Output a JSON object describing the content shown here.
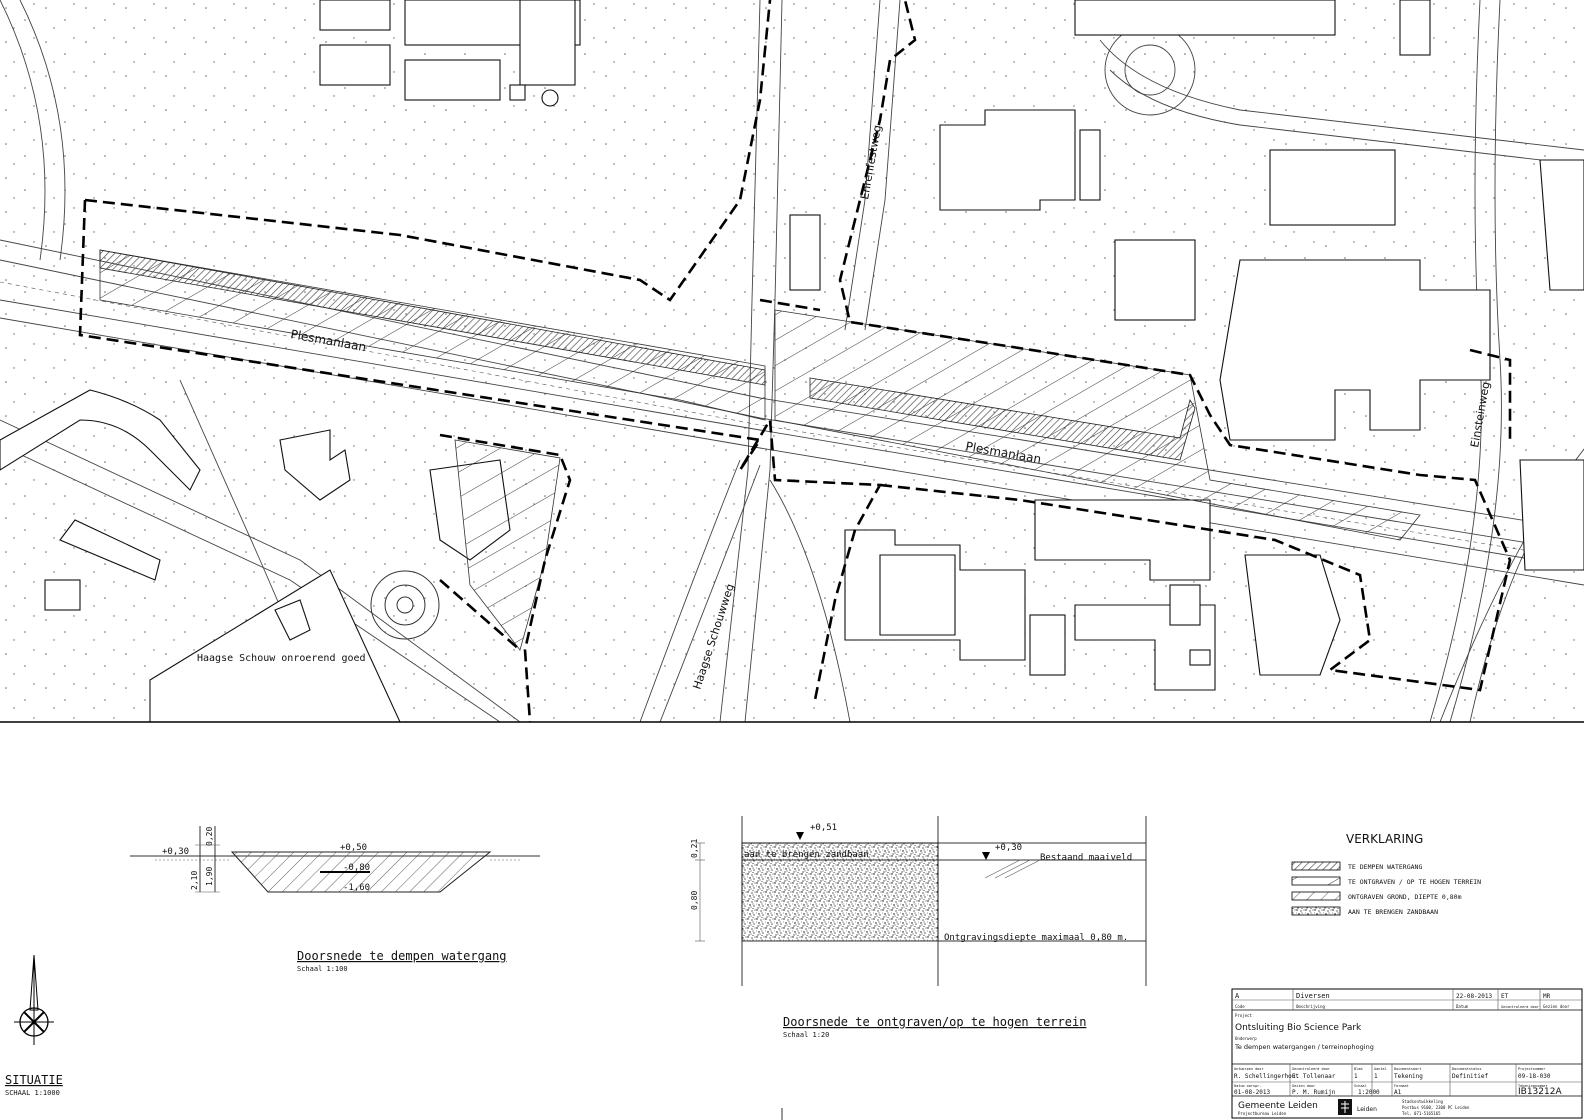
{
  "map": {
    "street_plesmanlaan_west": "Plesmanlaan",
    "street_plesmanlaan_east": "Plesmanlaan",
    "street_ehrenfestweg": "Ehrenfestweg",
    "street_einsteinweg": "Einsteinweg",
    "street_haagse_schouwweg": "Haagse Schouwweg",
    "label_haagse_schouw": "Haagse Schouw onroerend goed"
  },
  "section_water": {
    "title": "Doorsnede te dempen watergang",
    "scale": "Schaal 1:100",
    "level_left": "+0,30",
    "level_top": "+0,50",
    "level_mid": "-0,80",
    "level_bottom": "-1,60",
    "dim_top": "0,20",
    "dim_height": "2,10",
    "dim_inner": "1,90"
  },
  "section_terrain": {
    "title": "Doorsnede te ontgraven/op te hogen terrein",
    "scale": "Schaal 1:20",
    "level_top": "+0,51",
    "level_right": "+0,30",
    "label_fill": "aan te brengen zandbaan",
    "label_existing": "Bestaand maaiveld",
    "label_depth": "Ontgravingsdiepte maximaal 0,80 m.",
    "dim_top": "0,21",
    "dim_main": "0,80"
  },
  "legend": {
    "title": "VERKLARING",
    "items": [
      "TE DEMPEN WATERGANG",
      "TE ONTGRAVEN / OP TE HOGEN TERREIN",
      "ONTGRAVEN GROND, DIEPTE 0,80m",
      "AAN TE BRENGEN ZANDBAAN"
    ]
  },
  "situation": {
    "title": "SITUATIE",
    "scale": "SCHAAL 1:1000"
  },
  "titleblock": {
    "rev_letter": "A",
    "rev_desc": "Diversen",
    "rev_date": "22-08-2013",
    "rev_by": "ET",
    "rev_check": "MR",
    "lbl_code": "Code",
    "lbl_omschrijving": "Omschrijving",
    "lbl_datum": "Datum",
    "lbl_getekend": "Gecontroleerd door",
    "lbl_gezien": "Gezien door",
    "lbl_project": "Project",
    "project": "Ontsluiting Bio Science Park",
    "lbl_onderwerp": "Onderwerp",
    "subject": "Te dempen watergangen / terreinophoging",
    "lbl_ontworpen": "Ontworpen door",
    "designer": "R. Schellingerhout",
    "lbl_gecontroleerd": "Gecontroleerd door",
    "checker": "E. Tollenaar",
    "lbl_blad": "Blad",
    "sheet": "1",
    "lbl_aantal": "Aantal",
    "sheet_count": "1",
    "lbl_soort": "Documentsoort",
    "doc_type": "Tekening",
    "lbl_status": "Documentstatus",
    "doc_status": "Definitief",
    "lbl_projectnr": "Projectnummer",
    "project_no": "09-18-030",
    "lbl_datum_orig": "Datum oorspr.",
    "date": "01-08-2013",
    "lbl_gezien2": "Gezien door",
    "reviewer": "P. M. Rumijn",
    "lbl_schaal": "Schaal",
    "scale": "1:2000",
    "lbl_formaat": "Formaat",
    "format": "A1",
    "lbl_tekeningnr": "Tekeningnummer",
    "drawing_no": "IB13212A",
    "org": "Gemeente Leiden",
    "org_dept": "Projectbureau Leiden",
    "org_city": "Leiden",
    "addr1": "Stadsontwikkeling",
    "addr2": "Postbus 9100, 2300 PC Leiden",
    "addr3": "Tel. 071-5165165"
  }
}
